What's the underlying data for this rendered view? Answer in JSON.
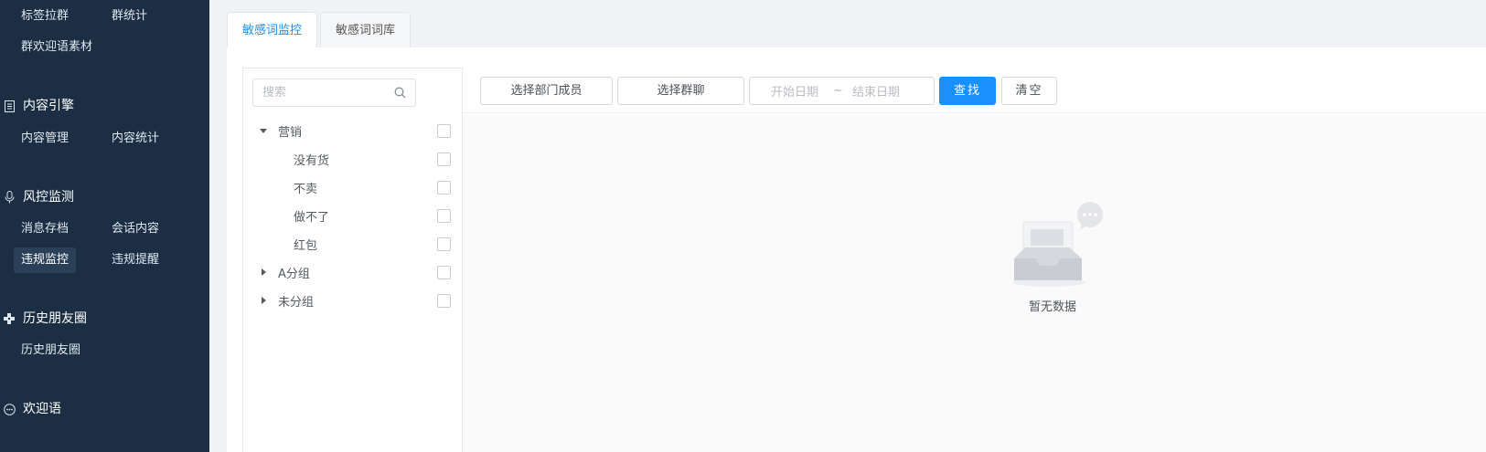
{
  "sidebar": {
    "top_items": [
      "标签拉群",
      "群统计",
      "群欢迎语素材"
    ],
    "groups": [
      {
        "title": "内容引擎",
        "icon": "document-list-icon",
        "items": [
          "内容管理",
          "内容统计"
        ]
      },
      {
        "title": "风控监测",
        "icon": "microphone-icon",
        "items": [
          "消息存档",
          "会话内容",
          "违规监控",
          "违规提醒"
        ],
        "active_item": "违规监控"
      },
      {
        "title": "历史朋友圈",
        "icon": "grid-plus-icon",
        "items": [
          "历史朋友圈"
        ]
      },
      {
        "title": "欢迎语",
        "icon": "chat-bubble-icon",
        "items": []
      }
    ]
  },
  "tabs": [
    {
      "label": "敏感词监控",
      "active": true
    },
    {
      "label": "敏感词词库",
      "active": false
    }
  ],
  "tree": {
    "search_placeholder": "搜索",
    "nodes": [
      {
        "label": "营销",
        "expanded": true,
        "children": [
          "没有货",
          "不卖",
          "做不了",
          "红包"
        ]
      },
      {
        "label": "A分组",
        "expanded": false
      },
      {
        "label": "未分组",
        "expanded": false
      }
    ]
  },
  "filters": {
    "select_member": "选择部门成员",
    "select_group": "选择群聊",
    "start_date_placeholder": "开始日期",
    "range_separator": "~",
    "end_date_placeholder": "结束日期",
    "search_button": "查找",
    "clear_button": "清空"
  },
  "empty_state": {
    "text": "暂无数据"
  },
  "colors": {
    "sidebar_bg": "#1b2e44",
    "primary": "#1890ff",
    "active_tab_text": "#1890ff"
  }
}
